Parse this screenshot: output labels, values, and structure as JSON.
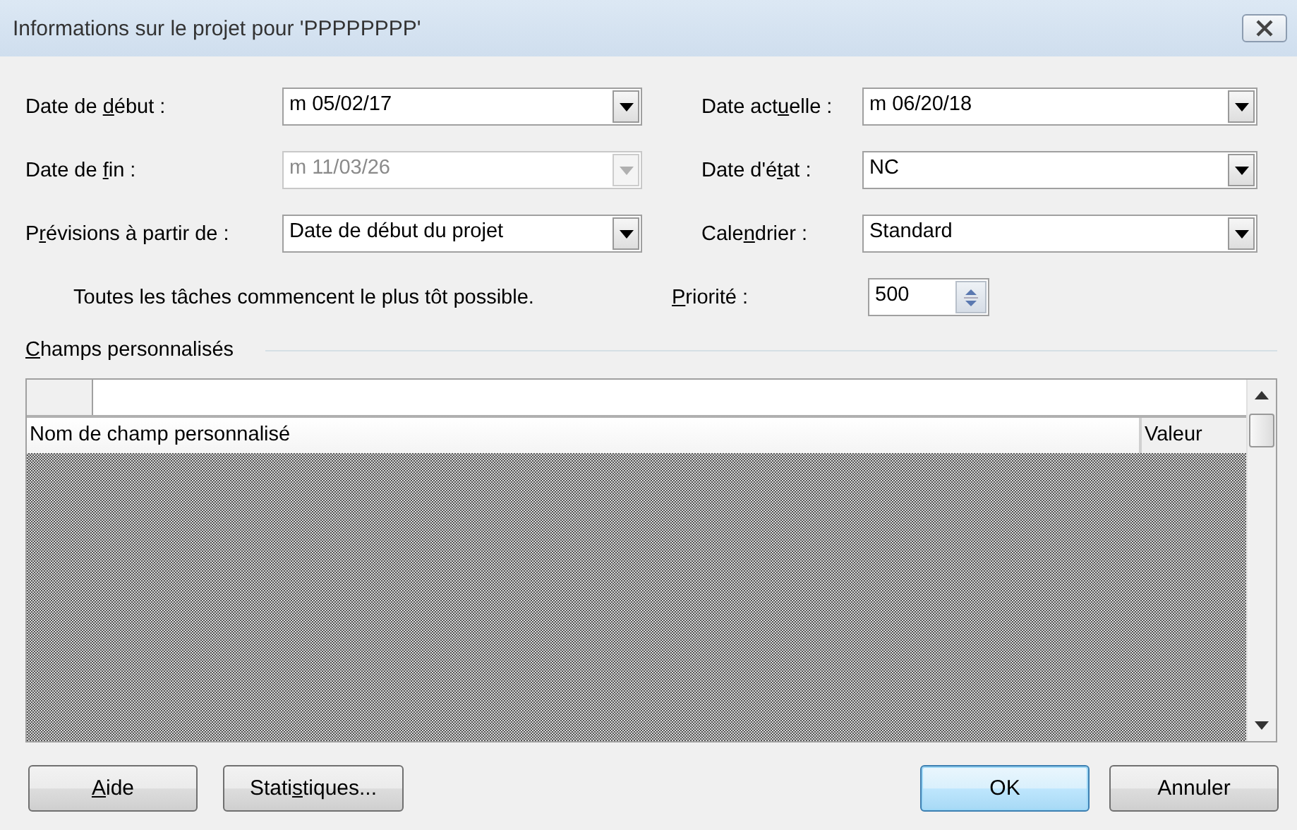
{
  "window": {
    "title": "Informations sur le projet pour 'PPPPPPPP'"
  },
  "left_fields": [
    {
      "label": [
        {
          "t": "Date de ",
          "underlined": false
        },
        {
          "t": "d",
          "underlined": true
        },
        {
          "t": "ébut :",
          "underlined": false
        }
      ],
      "value": "m 05/02/17",
      "kind": "dropdown",
      "disabled": false
    },
    {
      "label": [
        {
          "t": "Date de ",
          "underlined": false
        },
        {
          "t": "f",
          "underlined": true
        },
        {
          "t": "in :",
          "underlined": false
        }
      ],
      "value": "m 11/03/26",
      "kind": "dropdown",
      "disabled": true
    },
    {
      "label": [
        {
          "t": "P",
          "underlined": false
        },
        {
          "t": "r",
          "underlined": true
        },
        {
          "t": "évisions à partir de :",
          "underlined": false
        }
      ],
      "value": "Date de début du projet",
      "kind": "dropdown",
      "disabled": false
    }
  ],
  "note": "Toutes les tâches commencent le plus tôt possible.",
  "right_fields": [
    {
      "label": [
        {
          "t": "Date act",
          "underlined": false
        },
        {
          "t": "u",
          "underlined": true
        },
        {
          "t": "elle :",
          "underlined": false
        }
      ],
      "value": "m 06/20/18",
      "kind": "dropdown",
      "disabled": false
    },
    {
      "label": [
        {
          "t": "Date d'é",
          "underlined": false
        },
        {
          "t": "t",
          "underlined": true
        },
        {
          "t": "at :",
          "underlined": false
        }
      ],
      "value": "NC",
      "kind": "dropdown",
      "disabled": false
    },
    {
      "label": [
        {
          "t": "Cale",
          "underlined": false
        },
        {
          "t": "n",
          "underlined": true
        },
        {
          "t": "drier :",
          "underlined": false
        }
      ],
      "value": "Standard",
      "kind": "dropdown",
      "disabled": false
    },
    {
      "label": [
        {
          "t": "P",
          "underlined": true
        },
        {
          "t": "riorité :",
          "underlined": false
        }
      ],
      "value": "500",
      "kind": "spinner",
      "disabled": false
    }
  ],
  "custom_fields": {
    "label": [
      {
        "t": "C",
        "underlined": true
      },
      {
        "t": "hamps personnalisés",
        "underlined": false
      }
    ],
    "columns": [
      "Nom de champ personnalisé",
      "Valeur"
    ]
  },
  "buttons": [
    {
      "label": [
        {
          "t": "A",
          "underlined": true
        },
        {
          "t": "ide",
          "underlined": false
        }
      ],
      "default": false
    },
    {
      "label": [
        {
          "t": "Stati",
          "underlined": false
        },
        {
          "t": "s",
          "underlined": true
        },
        {
          "t": "tiques...",
          "underlined": false
        }
      ],
      "default": false
    },
    {
      "label": [
        {
          "t": "OK",
          "underlined": false
        }
      ],
      "default": true
    },
    {
      "label": [
        {
          "t": "Annuler",
          "underlined": false
        }
      ],
      "default": false
    }
  ]
}
